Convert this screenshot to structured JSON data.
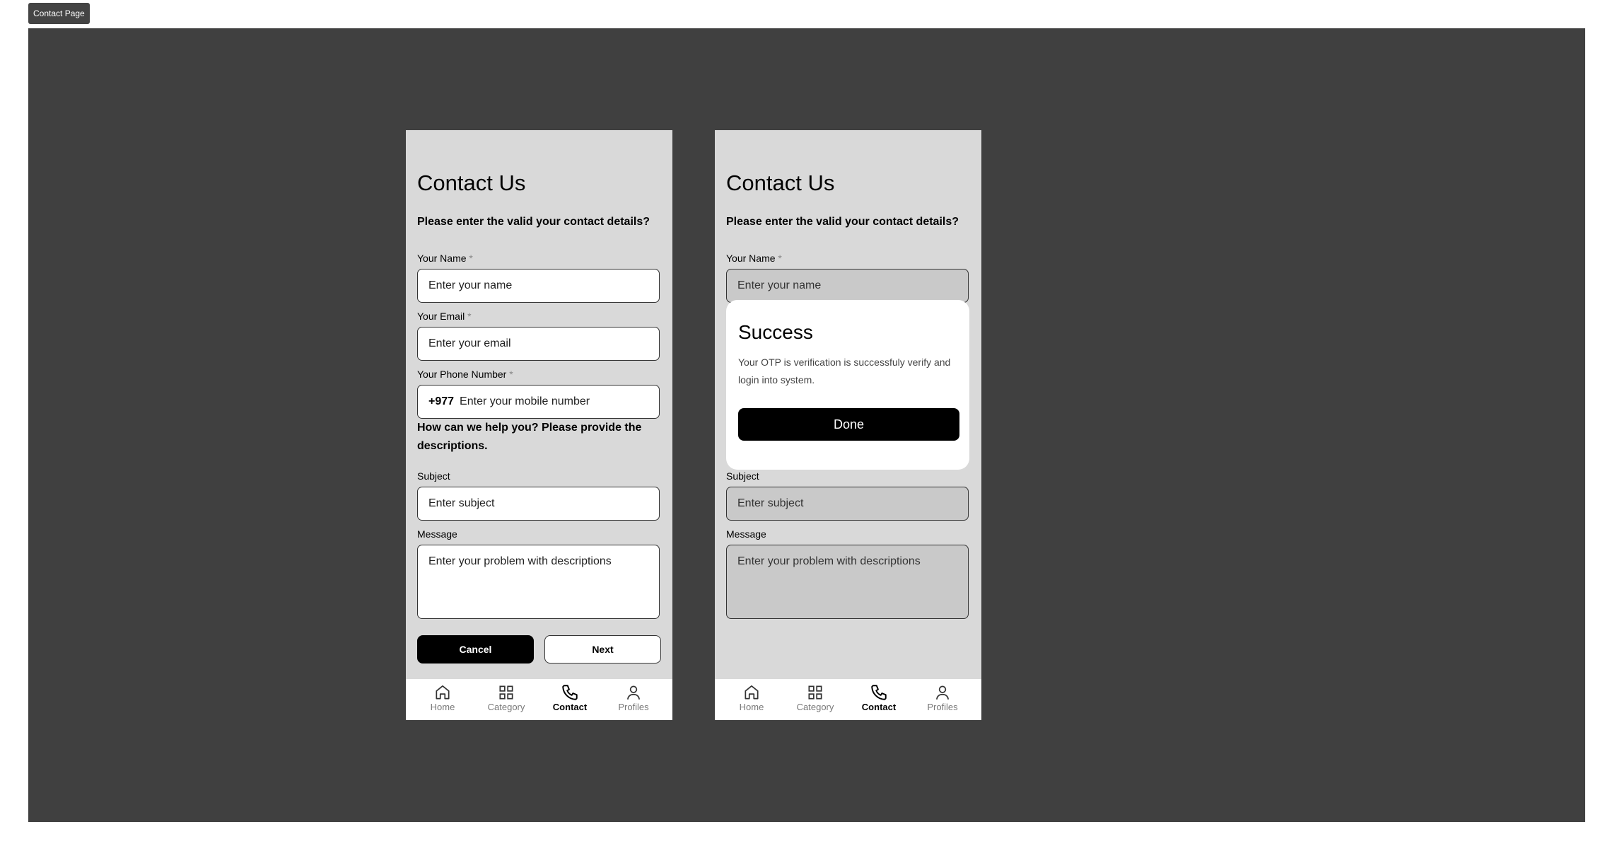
{
  "frame_label": "Contact Page",
  "screens": [
    {
      "title": "Contact Us",
      "lead": "Please enter the valid your contact details?",
      "name_label": "Your Name",
      "required_mark": "*",
      "name_placeholder": "Enter your name",
      "email_label": "Your Email",
      "email_placeholder": "Enter your email",
      "phone_label": "Your Phone Number",
      "phone_prefix": "+977",
      "phone_placeholder": "Enter your mobile number",
      "help": "How can we help you? Please provide the descriptions.",
      "subject_label": "Subject",
      "subject_placeholder": "Enter subject",
      "message_label": "Message",
      "message_placeholder": "Enter your problem with descriptions",
      "cancel": "Cancel",
      "next": "Next"
    },
    {
      "title": "Contact Us",
      "lead": "Please enter the valid your contact details?",
      "name_label": "Your Name",
      "required_mark": "*",
      "name_placeholder": "Enter your name",
      "subject_label": "Subject",
      "subject_placeholder": "Enter subject",
      "message_label": "Message",
      "message_placeholder": "Enter your problem with descriptions",
      "modal": {
        "title": "Success",
        "body": "Your OTP is verification is successfuly verify and login into system.",
        "done": "Done"
      }
    }
  ],
  "nav": [
    {
      "label": "Home",
      "icon": "home-icon",
      "active": false
    },
    {
      "label": "Category",
      "icon": "grid-icon",
      "active": false
    },
    {
      "label": "Contact",
      "icon": "phone-icon",
      "active": true
    },
    {
      "label": "Profiles",
      "icon": "user-icon",
      "active": false
    }
  ],
  "colors": {
    "canvas": "#404040",
    "screen": "#d9d9d9",
    "primary": "#000000"
  }
}
